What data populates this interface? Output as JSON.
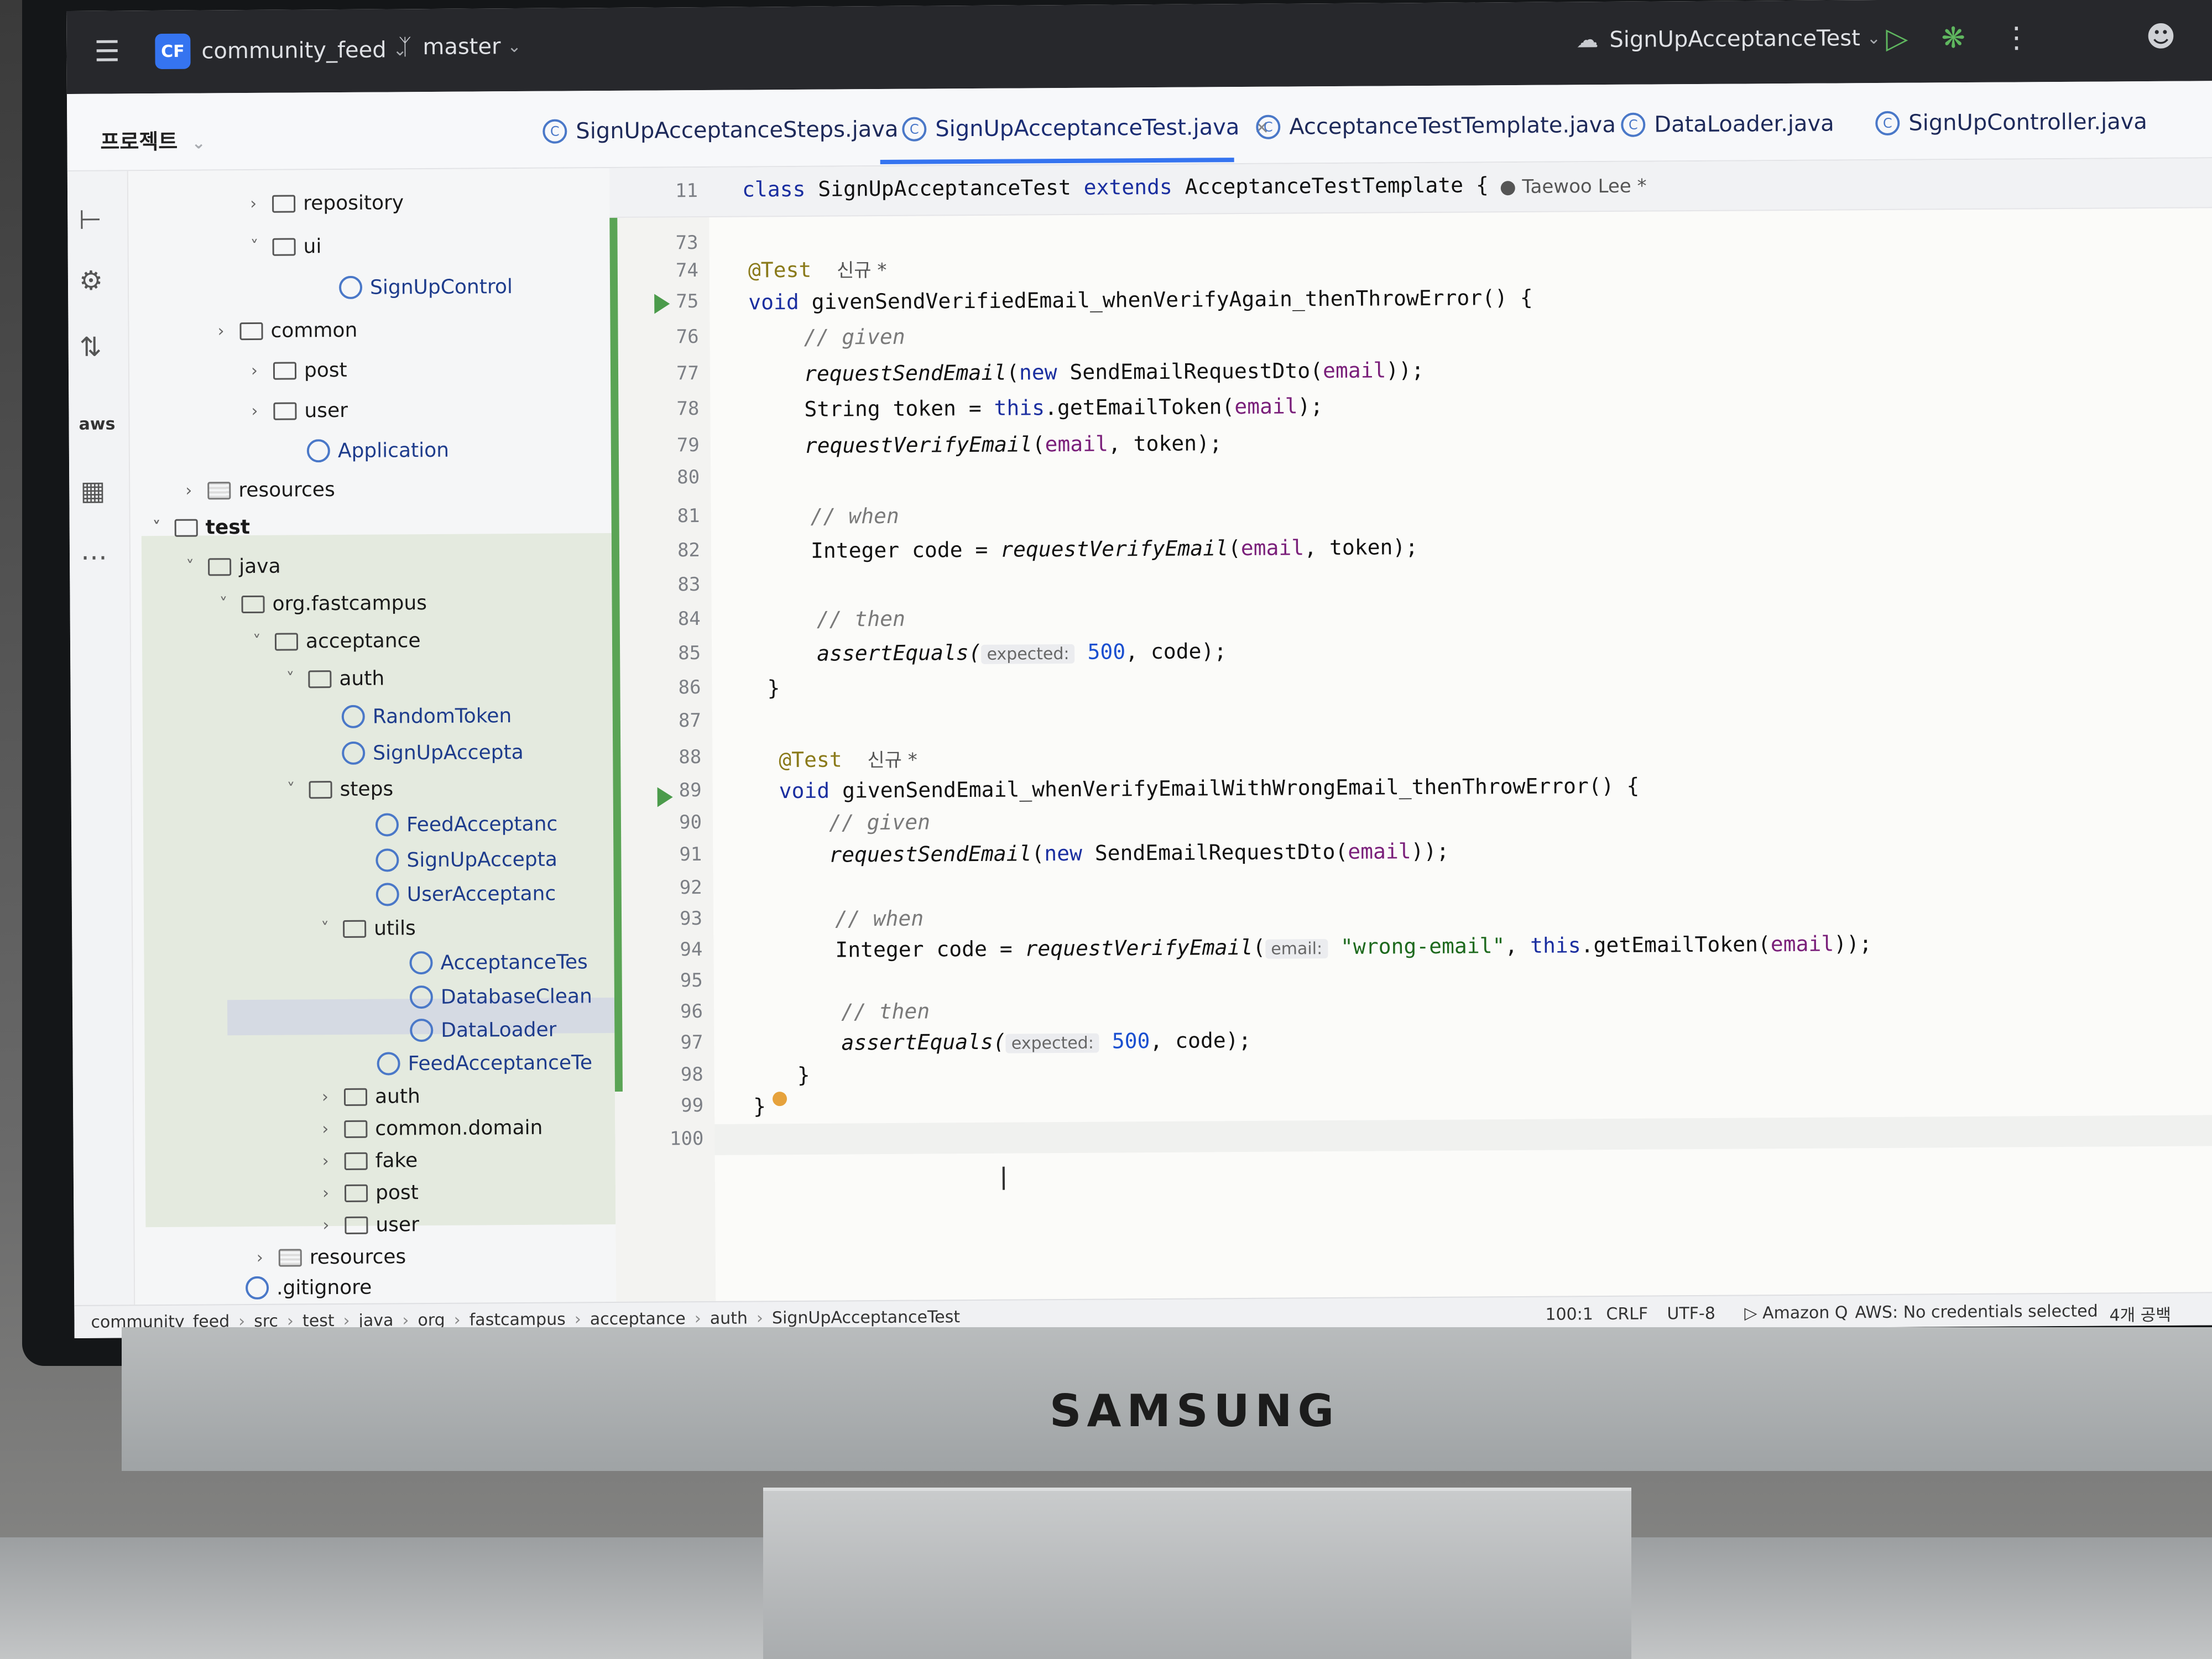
{
  "titlebar": {
    "project_badge": "CF",
    "project_name": "community_feed",
    "branch": "master",
    "run_config": "SignUpAcceptanceTest",
    "icons": [
      "menu-icon",
      "branch-icon",
      "run-icon",
      "debug-icon",
      "more-icon",
      "profile-icon",
      "search-icon"
    ]
  },
  "project_panel": {
    "label": "프로젝트"
  },
  "tabs": [
    {
      "label": "SignUpAcceptanceSteps.java",
      "active": false
    },
    {
      "label": "SignUpAcceptanceTest.java",
      "active": true,
      "close": "×"
    },
    {
      "label": "AcceptanceTestTemplate.java",
      "active": false
    },
    {
      "label": "DataLoader.java",
      "active": false
    },
    {
      "label": "SignUpController.java",
      "active": false
    }
  ],
  "tree": [
    {
      "label": "repository",
      "kind": "folder",
      "expand": ">"
    },
    {
      "label": "ui",
      "kind": "folder",
      "expand": "v"
    },
    {
      "label": "SignUpControl",
      "kind": "class"
    },
    {
      "label": "common",
      "kind": "folder",
      "expand": ">"
    },
    {
      "label": "post",
      "kind": "folder",
      "expand": ">"
    },
    {
      "label": "user",
      "kind": "folder",
      "expand": ">"
    },
    {
      "label": "Application",
      "kind": "class"
    },
    {
      "label": "resources",
      "kind": "resources",
      "expand": ">"
    },
    {
      "label": "test",
      "kind": "folder",
      "expand": "v"
    },
    {
      "label": "java",
      "kind": "folder",
      "expand": "v"
    },
    {
      "label": "org.fastcampus",
      "kind": "folder",
      "expand": "v"
    },
    {
      "label": "acceptance",
      "kind": "folder",
      "expand": "v"
    },
    {
      "label": "auth",
      "kind": "folder",
      "expand": "v"
    },
    {
      "label": "RandomToken",
      "kind": "class"
    },
    {
      "label": "SignUpAccepta",
      "kind": "class"
    },
    {
      "label": "steps",
      "kind": "folder",
      "expand": "v"
    },
    {
      "label": "FeedAcceptanc",
      "kind": "class"
    },
    {
      "label": "SignUpAccepta",
      "kind": "class"
    },
    {
      "label": "UserAcceptanc",
      "kind": "class"
    },
    {
      "label": "utils",
      "kind": "folder",
      "expand": "v"
    },
    {
      "label": "AcceptanceTes",
      "kind": "class"
    },
    {
      "label": "DatabaseClean",
      "kind": "class"
    },
    {
      "label": "DataLoader",
      "kind": "class",
      "selected": true
    },
    {
      "label": "FeedAcceptanceTe",
      "kind": "class"
    },
    {
      "label": "auth",
      "kind": "folder",
      "expand": ">"
    },
    {
      "label": "common.domain",
      "kind": "folder",
      "expand": ">"
    },
    {
      "label": "fake",
      "kind": "folder",
      "expand": ">"
    },
    {
      "label": "post",
      "kind": "folder",
      "expand": ">"
    },
    {
      "label": "user",
      "kind": "folder",
      "expand": ">"
    },
    {
      "label": "resources",
      "kind": "resources",
      "expand": ">"
    },
    {
      "label": ".gitignore",
      "kind": "file"
    }
  ],
  "editor": {
    "sticky_line_no": "11",
    "sticky_code": "class SignUpAcceptanceTest extends AcceptanceTestTemplate {",
    "sticky_author": "Taewoo Lee *",
    "line_numbers": [
      "73",
      "74",
      "75",
      "76",
      "77",
      "78",
      "79",
      "80",
      "81",
      "82",
      "83",
      "84",
      "85",
      "86",
      "87",
      "88",
      "89",
      "90",
      "91",
      "92",
      "93",
      "94",
      "95",
      "96",
      "97",
      "98",
      "99",
      "100"
    ],
    "code": {
      "l74_ann": "@Test",
      "l74_tag": "신규 *",
      "l75_void": "void",
      "l75_name": " givenSendVerifiedEmail_whenVerifyAgain_thenThrowError() {",
      "l76": "// given",
      "l77_a": "requestSendEmail",
      "l77_b": "(",
      "l77_new": "new",
      "l77_c": " SendEmailRequestDto(",
      "l77_var": "email",
      "l77_d": "));",
      "l78_a": "String token = ",
      "l78_this": "this",
      "l78_b": ".getEmailToken(",
      "l78_var": "email",
      "l78_c": ");",
      "l79_a": "requestVerifyEmail",
      "l79_b": "(",
      "l79_var": "email",
      "l79_c": ", token);",
      "l81": "// when",
      "l82_a": "Integer code = ",
      "l82_b": "requestVerifyEmail",
      "l82_c": "(",
      "l82_var": "email",
      "l82_d": ", token);",
      "l84": "// then",
      "l85_a": "assertEquals(",
      "l85_hint": "expected:",
      "l85_num": "500",
      "l85_b": ", code);",
      "l86": "}",
      "l88_ann": "@Test",
      "l88_tag": "신규 *",
      "l89_void": "void",
      "l89_name": " givenSendEmail_whenVerifyEmailWithWrongEmail_thenThrowError() {",
      "l90": "// given",
      "l91_a": "requestSendEmail",
      "l91_b": "(",
      "l91_new": "new",
      "l91_c": " SendEmailRequestDto(",
      "l91_var": "email",
      "l91_d": "));",
      "l93": "// when",
      "l94_a": "Integer code = ",
      "l94_b": "requestVerifyEmail",
      "l94_c": "(",
      "l94_hint": "email:",
      "l94_str": "\"wrong-email\"",
      "l94_d": ", ",
      "l94_this": "this",
      "l94_e": ".getEmailToken(",
      "l94_var": "email",
      "l94_f": "));",
      "l96": "// then",
      "l97_a": "assertEquals(",
      "l97_hint": "expected:",
      "l97_num": "500",
      "l97_b": ", code);",
      "l98": "}",
      "l99": "}"
    }
  },
  "statusbar": {
    "breadcrumb": [
      "community_feed",
      "src",
      "test",
      "java",
      "org",
      "fastcampus",
      "acceptance",
      "auth",
      "SignUpAcceptanceTest"
    ],
    "position": "100:1",
    "line_sep": "CRLF",
    "encoding": "UTF-8",
    "amazon_q": "Amazon Q",
    "aws": "AWS: No credentials selected",
    "indent": "4개 공백"
  },
  "device": {
    "brand": "SAMSUNG"
  }
}
